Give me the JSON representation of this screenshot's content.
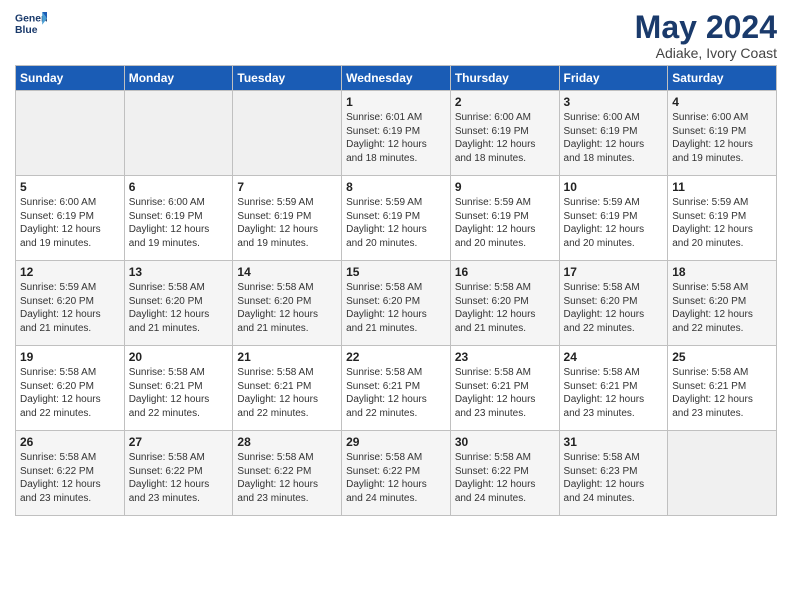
{
  "header": {
    "logo_line1": "General",
    "logo_line2": "Blue",
    "title": "May 2024",
    "subtitle": "Adiake, Ivory Coast"
  },
  "columns": [
    "Sunday",
    "Monday",
    "Tuesday",
    "Wednesday",
    "Thursday",
    "Friday",
    "Saturday"
  ],
  "weeks": [
    [
      {
        "day": "",
        "info": ""
      },
      {
        "day": "",
        "info": ""
      },
      {
        "day": "",
        "info": ""
      },
      {
        "day": "1",
        "info": "Sunrise: 6:01 AM\nSunset: 6:19 PM\nDaylight: 12 hours\nand 18 minutes."
      },
      {
        "day": "2",
        "info": "Sunrise: 6:00 AM\nSunset: 6:19 PM\nDaylight: 12 hours\nand 18 minutes."
      },
      {
        "day": "3",
        "info": "Sunrise: 6:00 AM\nSunset: 6:19 PM\nDaylight: 12 hours\nand 18 minutes."
      },
      {
        "day": "4",
        "info": "Sunrise: 6:00 AM\nSunset: 6:19 PM\nDaylight: 12 hours\nand 19 minutes."
      }
    ],
    [
      {
        "day": "5",
        "info": "Sunrise: 6:00 AM\nSunset: 6:19 PM\nDaylight: 12 hours\nand 19 minutes."
      },
      {
        "day": "6",
        "info": "Sunrise: 6:00 AM\nSunset: 6:19 PM\nDaylight: 12 hours\nand 19 minutes."
      },
      {
        "day": "7",
        "info": "Sunrise: 5:59 AM\nSunset: 6:19 PM\nDaylight: 12 hours\nand 19 minutes."
      },
      {
        "day": "8",
        "info": "Sunrise: 5:59 AM\nSunset: 6:19 PM\nDaylight: 12 hours\nand 20 minutes."
      },
      {
        "day": "9",
        "info": "Sunrise: 5:59 AM\nSunset: 6:19 PM\nDaylight: 12 hours\nand 20 minutes."
      },
      {
        "day": "10",
        "info": "Sunrise: 5:59 AM\nSunset: 6:19 PM\nDaylight: 12 hours\nand 20 minutes."
      },
      {
        "day": "11",
        "info": "Sunrise: 5:59 AM\nSunset: 6:19 PM\nDaylight: 12 hours\nand 20 minutes."
      }
    ],
    [
      {
        "day": "12",
        "info": "Sunrise: 5:59 AM\nSunset: 6:20 PM\nDaylight: 12 hours\nand 21 minutes."
      },
      {
        "day": "13",
        "info": "Sunrise: 5:58 AM\nSunset: 6:20 PM\nDaylight: 12 hours\nand 21 minutes."
      },
      {
        "day": "14",
        "info": "Sunrise: 5:58 AM\nSunset: 6:20 PM\nDaylight: 12 hours\nand 21 minutes."
      },
      {
        "day": "15",
        "info": "Sunrise: 5:58 AM\nSunset: 6:20 PM\nDaylight: 12 hours\nand 21 minutes."
      },
      {
        "day": "16",
        "info": "Sunrise: 5:58 AM\nSunset: 6:20 PM\nDaylight: 12 hours\nand 21 minutes."
      },
      {
        "day": "17",
        "info": "Sunrise: 5:58 AM\nSunset: 6:20 PM\nDaylight: 12 hours\nand 22 minutes."
      },
      {
        "day": "18",
        "info": "Sunrise: 5:58 AM\nSunset: 6:20 PM\nDaylight: 12 hours\nand 22 minutes."
      }
    ],
    [
      {
        "day": "19",
        "info": "Sunrise: 5:58 AM\nSunset: 6:20 PM\nDaylight: 12 hours\nand 22 minutes."
      },
      {
        "day": "20",
        "info": "Sunrise: 5:58 AM\nSunset: 6:21 PM\nDaylight: 12 hours\nand 22 minutes."
      },
      {
        "day": "21",
        "info": "Sunrise: 5:58 AM\nSunset: 6:21 PM\nDaylight: 12 hours\nand 22 minutes."
      },
      {
        "day": "22",
        "info": "Sunrise: 5:58 AM\nSunset: 6:21 PM\nDaylight: 12 hours\nand 22 minutes."
      },
      {
        "day": "23",
        "info": "Sunrise: 5:58 AM\nSunset: 6:21 PM\nDaylight: 12 hours\nand 23 minutes."
      },
      {
        "day": "24",
        "info": "Sunrise: 5:58 AM\nSunset: 6:21 PM\nDaylight: 12 hours\nand 23 minutes."
      },
      {
        "day": "25",
        "info": "Sunrise: 5:58 AM\nSunset: 6:21 PM\nDaylight: 12 hours\nand 23 minutes."
      }
    ],
    [
      {
        "day": "26",
        "info": "Sunrise: 5:58 AM\nSunset: 6:22 PM\nDaylight: 12 hours\nand 23 minutes."
      },
      {
        "day": "27",
        "info": "Sunrise: 5:58 AM\nSunset: 6:22 PM\nDaylight: 12 hours\nand 23 minutes."
      },
      {
        "day": "28",
        "info": "Sunrise: 5:58 AM\nSunset: 6:22 PM\nDaylight: 12 hours\nand 23 minutes."
      },
      {
        "day": "29",
        "info": "Sunrise: 5:58 AM\nSunset: 6:22 PM\nDaylight: 12 hours\nand 24 minutes."
      },
      {
        "day": "30",
        "info": "Sunrise: 5:58 AM\nSunset: 6:22 PM\nDaylight: 12 hours\nand 24 minutes."
      },
      {
        "day": "31",
        "info": "Sunrise: 5:58 AM\nSunset: 6:23 PM\nDaylight: 12 hours\nand 24 minutes."
      },
      {
        "day": "",
        "info": ""
      }
    ]
  ]
}
